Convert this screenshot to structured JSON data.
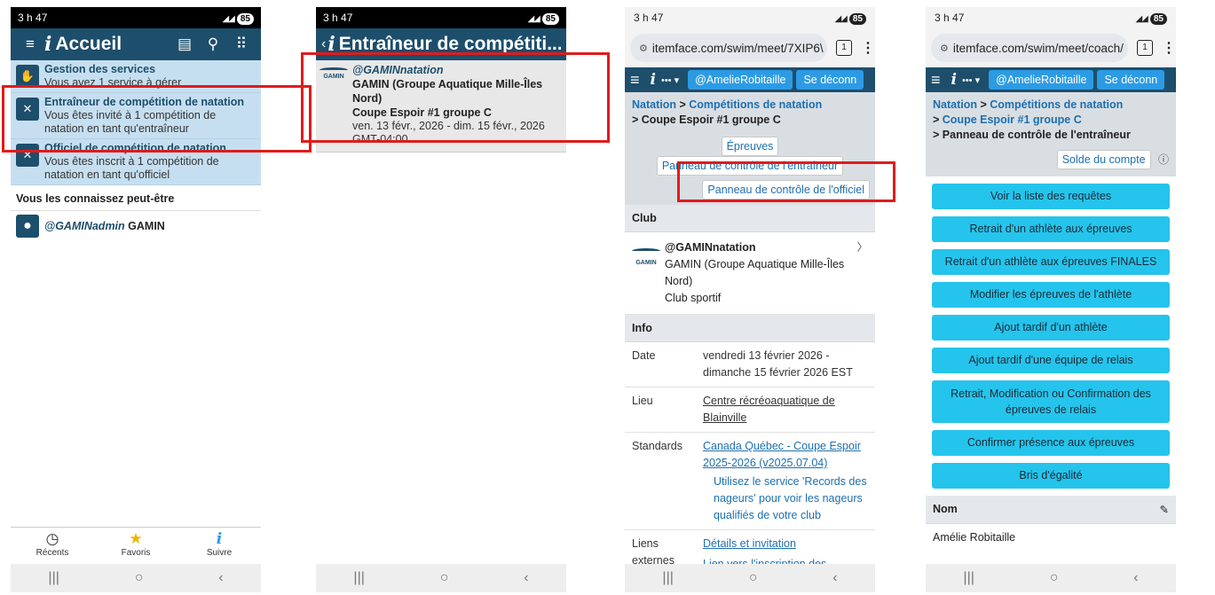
{
  "p1": {
    "status": {
      "time": "3 h 47",
      "battery": "85"
    },
    "appbar": {
      "title": "Accueil"
    },
    "services": [
      {
        "title": "Gestion des services",
        "sub": "Vous avez 1 service à gérer"
      },
      {
        "title": "Entraîneur de compétition de natation",
        "sub": "Vous êtes invité à 1 compétition de natation en tant qu'entraîneur"
      },
      {
        "title": "Officiel de compétition de natation",
        "sub": "Vous êtes inscrit à 1 compétition de natation en tant qu'officiel"
      }
    ],
    "section": "Vous les connaissez peut-être",
    "person": {
      "handle": "@GAMINadmin",
      "name": "GAMIN"
    },
    "nav": {
      "recent": "Récents",
      "fav": "Favoris",
      "follow": "Suivre"
    }
  },
  "p2": {
    "status": {
      "time": "3 h 47",
      "battery": "85"
    },
    "appbar": {
      "title": "Entraîneur de compétiti..."
    },
    "comp": {
      "handle": "@GAMINnatation",
      "club": "GAMIN (Groupe Aquatique Mille-Îles Nord)",
      "meet": "Coupe Espoir #1 groupe C",
      "dates": "ven. 13 févr., 2026 - dim. 15 févr., 2026",
      "tz": "GMT-04:00",
      "logo": "GAMIN"
    }
  },
  "p3": {
    "status": {
      "time": "3 h 47",
      "battery": "85"
    },
    "url": "itemface.com/swim/meet/7XIP6\\",
    "tabs": "1",
    "user": "@AmelieRobitaille",
    "logout": "Se déconn",
    "bc": {
      "a": "Natation",
      "sep": ">",
      "b": "Compétitions de natation",
      "c": "Coupe Espoir #1 groupe C"
    },
    "btn_events": "Épreuves",
    "btn_coach": "Panneau de contrôle de l'entraîneur",
    "btn_official": "Panneau de contrôle de l'officiel",
    "club_hdr": "Club",
    "club": {
      "handle": "@GAMINnatation",
      "name": "GAMIN (Groupe Aquatique Mille-Îles Nord)",
      "type": "Club sportif",
      "logo": "GAMIN"
    },
    "info_hdr": "Info",
    "date_k": "Date",
    "date_v": "vendredi 13 février 2026 - dimanche 15 février 2026 EST",
    "lieu_k": "Lieu",
    "lieu_v": "Centre récréoaquatique de Blainville",
    "std_k": "Standards",
    "std_v": "Canada Québec - Coupe Espoir 2025-2026 (v2025.07.04)",
    "std_note": "Utilisez le service 'Records des nageurs' pour voir les nageurs qualifiés de votre club",
    "links_k": "Liens externes",
    "link1": "Détails et invitation",
    "link2": "Lien vers l'inscription des officielles et officiels"
  },
  "p4": {
    "status": {
      "time": "3 h 47",
      "battery": "85"
    },
    "url": "itemface.com/swim/meet/coach/",
    "tabs": "1",
    "user": "@AmelieRobitaille",
    "logout": "Se déconn",
    "bc": {
      "a": "Natation",
      "b": "Compétitions de natation",
      "c": "Coupe Espoir #1 groupe C",
      "d": "Panneau de contrôle de l'entraîneur"
    },
    "balance": "Solde du compte",
    "buttons": [
      "Voir la liste des requêtes",
      "Retrait d'un athlète aux épreuves",
      "Retrait d'un athlète aux épreuves FINALES",
      "Modifier les épreuves de l'athlète",
      "Ajout tardif d'un athlète",
      "Ajout tardif d'une équipe de relais",
      "Retrait, Modification ou Confirmation des épreuves de relais",
      "Confirmer présence aux épreuves",
      "Bris d'égalité"
    ],
    "name_hdr": "Nom",
    "name_val": "Amélie Robitaille"
  }
}
